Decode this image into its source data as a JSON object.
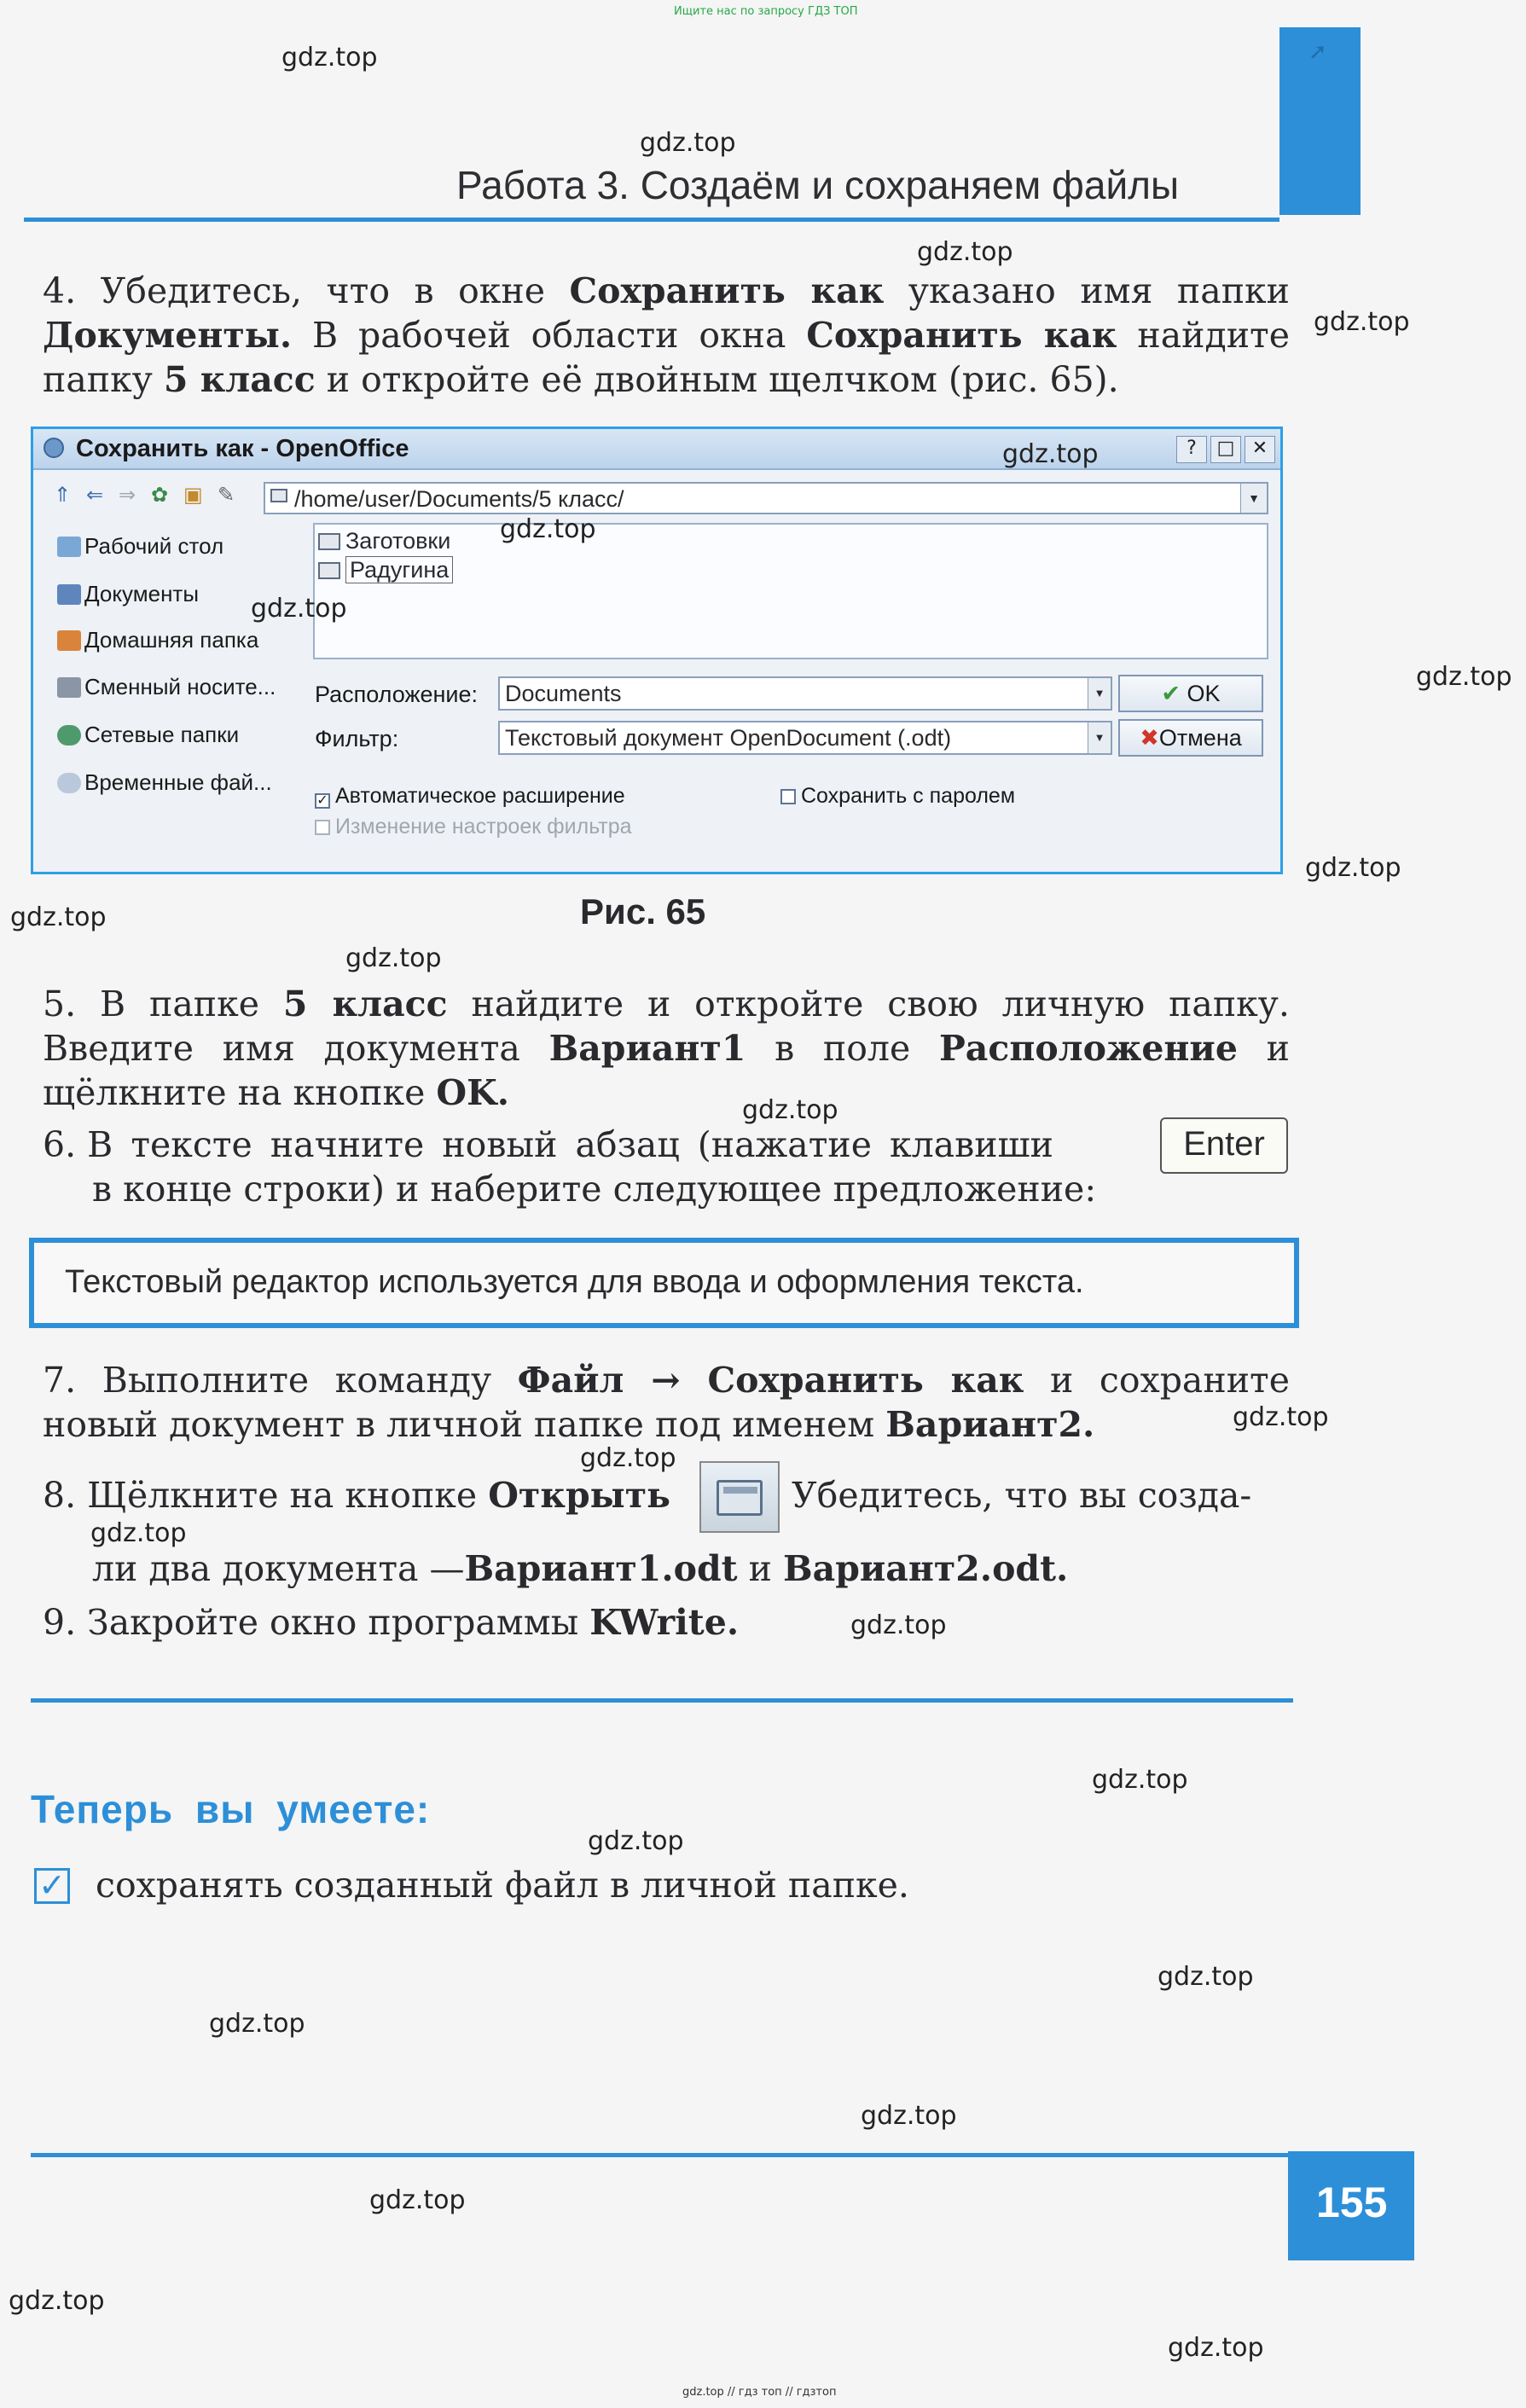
{
  "top_note": "Ищите нас по запросу ГДЗ ТОП",
  "header": {
    "title": "Работа 3. Создаём и сохраняем файлы"
  },
  "step4": {
    "num": "4.",
    "t1": "Убедитесь, что в окне ",
    "b1": "Сохранить как",
    "t2": " указано имя папки ",
    "b2": "Документы.",
    "t3": " В рабочей области окна ",
    "b3": "Сохранить как",
    "t4": " найдите папку ",
    "b4": "5 класс",
    "t5": " и откройте её двойным щелчком (рис. 65)."
  },
  "dialog": {
    "title": "Сохранить как - OpenOffice",
    "title_buttons": [
      "?",
      "□",
      "✕"
    ],
    "path": "/home/user/Documents/5 класс/",
    "sidebar": [
      {
        "icon": "desktop-icon",
        "label": "Рабочий стол"
      },
      {
        "icon": "documents-icon",
        "label": "Документы"
      },
      {
        "icon": "home-icon",
        "label": "Домашняя папка"
      },
      {
        "icon": "removable-drive-icon",
        "label": "Сменный носите..."
      },
      {
        "icon": "network-icon",
        "label": "Сетевые папки"
      },
      {
        "icon": "temp-folder-icon",
        "label": "Временные фай..."
      }
    ],
    "files": [
      "Заготовки",
      "Радугина"
    ],
    "location_label": "Расположение:",
    "location_value": "Documents",
    "filter_label": "Фильтр:",
    "filter_value": "Текстовый документ OpenDocument (.odt)",
    "ok_label": "OK",
    "cancel_label": "Отмена",
    "auto_ext_label": "Автоматическое расширение",
    "password_label": "Сохранить с паролем",
    "filter_settings_label": "Изменение настроек фильтра"
  },
  "caption": "Рис. 65",
  "step5": {
    "num": "5.",
    "t1": "В папке ",
    "b1": "5 класс",
    "t2": " найдите и откройте свою личную папку. Введите имя документа ",
    "b2": "Вариант1",
    "t3": " в поле ",
    "b3": "Расположение",
    "t4": " и щёлкните на кнопке ",
    "b4": "OK."
  },
  "step6": {
    "num": "6.",
    "t1": "В тексте начните новый абзац (нажатие клавиши",
    "key": "Enter",
    "t2": "в конце строки) и наберите следующее предложение:"
  },
  "quote": "Текстовый редактор используется для ввода и оформления текста.",
  "step7": {
    "num": "7.",
    "t1": "Выполните команду ",
    "b1": "Файл → Сохранить как",
    "t2": " и сохраните новый документ в личной папке под именем ",
    "b2": "Вариант2."
  },
  "step8": {
    "num": "8.",
    "t1": "Щёлкните на кнопке ",
    "b1": "Открыть",
    "t2": ". Убедитесь, что вы созда-",
    "t3": "ли два документа — ",
    "b2": "Вариант1.odt",
    "t4": " и ",
    "b3": "Вариант2.odt."
  },
  "step9": {
    "num": "9.",
    "t1": "Закройте окно программы ",
    "b1": "KWrite."
  },
  "now_title": "Теперь вы умеете:",
  "skill": "сохранять созданный файл в личной папке.",
  "page_number": "155",
  "watermark": "gdz.top",
  "bottom_note": "gdz.top // гдз топ // гдзтоп"
}
